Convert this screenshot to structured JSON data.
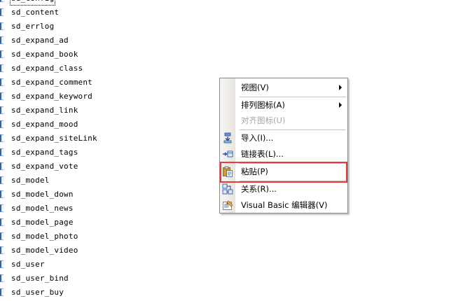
{
  "tables": [
    "sd_config",
    "sd_content",
    "sd_errlog",
    "sd_expand_ad",
    "sd_expand_book",
    "sd_expand_class",
    "sd_expand_comment",
    "sd_expand_keyword",
    "sd_expand_link",
    "sd_expand_mood",
    "sd_expand_siteLink",
    "sd_expand_tags",
    "sd_expand_vote",
    "sd_model",
    "sd_model_down",
    "sd_model_news",
    "sd_model_page",
    "sd_model_photo",
    "sd_model_video",
    "sd_user",
    "sd_user_bind",
    "sd_user_buy"
  ],
  "context_menu": {
    "items": [
      {
        "label": "视图(V)",
        "icon": "",
        "submenu": true,
        "disabled": false
      },
      {
        "label": "排列图标(A)",
        "icon": "",
        "submenu": true,
        "disabled": false
      },
      {
        "label": "对齐图标(U)",
        "icon": "",
        "submenu": false,
        "disabled": true
      },
      {
        "label": "导入(I)...",
        "icon": "import-icon",
        "submenu": false,
        "disabled": false
      },
      {
        "label": "链接表(L)...",
        "icon": "link-table-icon",
        "submenu": false,
        "disabled": false
      },
      {
        "label": "粘贴(P)",
        "icon": "paste-icon",
        "submenu": false,
        "disabled": false
      },
      {
        "label": "关系(R)...",
        "icon": "relationships-icon",
        "submenu": false,
        "disabled": false
      },
      {
        "label": "Visual Basic 编辑器(V)",
        "icon": "vb-editor-icon",
        "submenu": false,
        "disabled": false
      }
    ]
  },
  "colors": {
    "highlight": "#e83a3a",
    "disabled_text": "#a7a6a0"
  }
}
